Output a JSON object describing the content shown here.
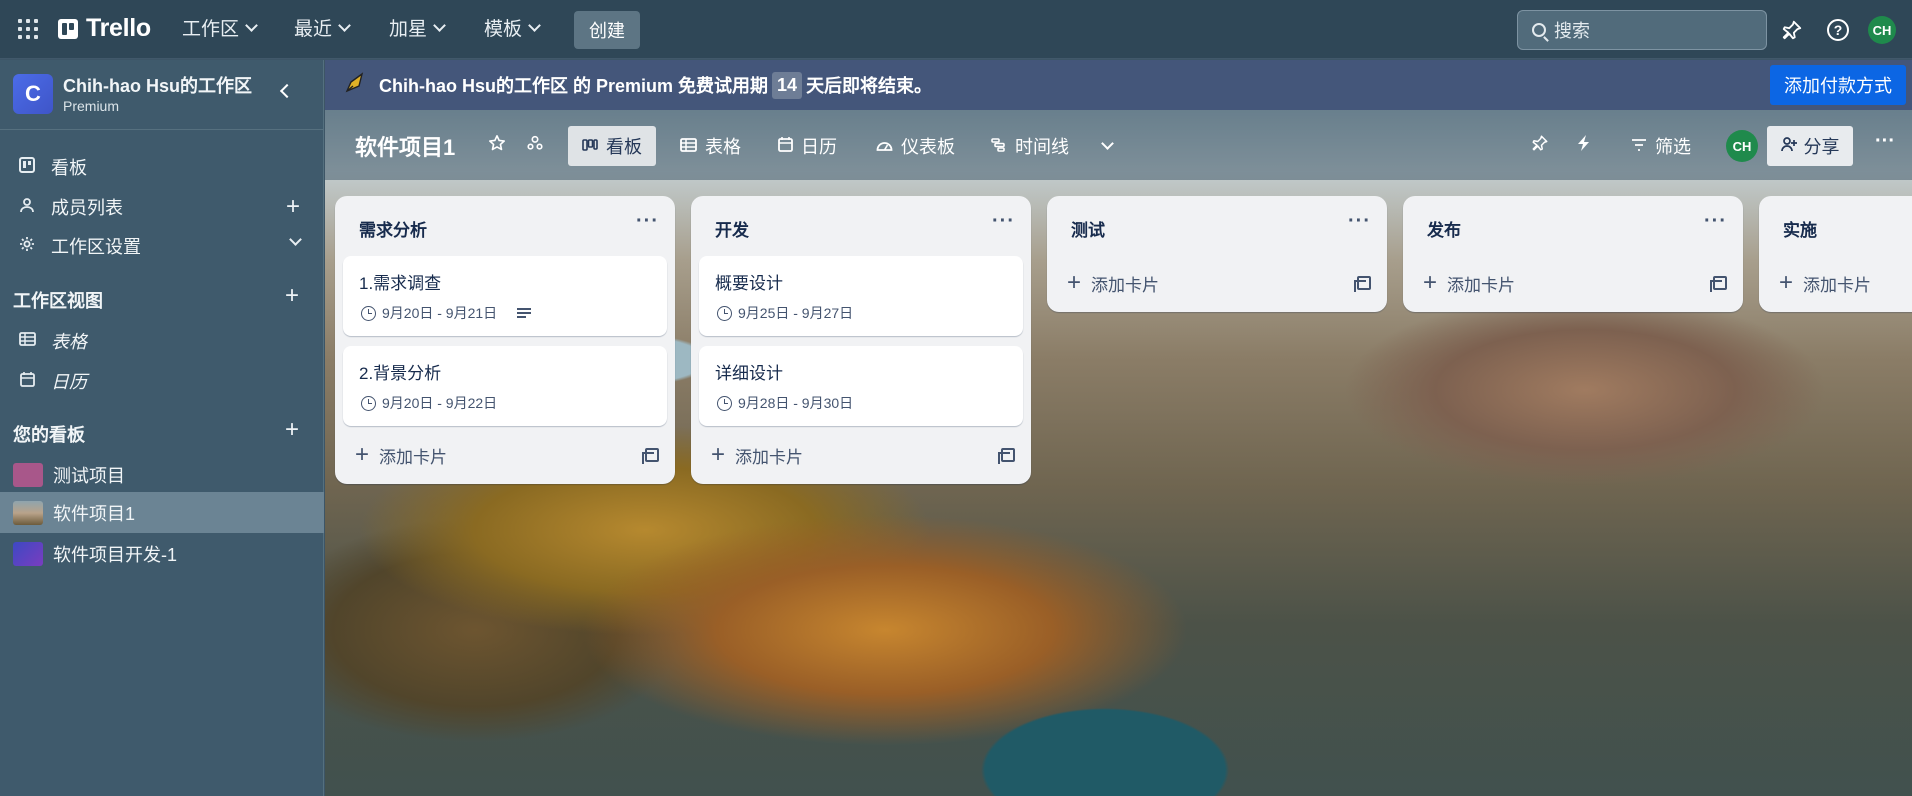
{
  "topbar": {
    "logo": "Trello",
    "menus": [
      "工作区",
      "最近",
      "加星",
      "模板"
    ],
    "create": "创建",
    "search_placeholder": "搜索",
    "avatar": "CH"
  },
  "sidebar": {
    "workspace_initial": "C",
    "workspace_name": "Chih-hao Hsu的工作区",
    "workspace_plan": "Premium",
    "nav": [
      {
        "label": "看板",
        "icon": "board-icon"
      },
      {
        "label": "成员列表",
        "icon": "person-icon"
      },
      {
        "label": "工作区设置",
        "icon": "gear-icon"
      }
    ],
    "views_heading": "工作区视图",
    "views": [
      {
        "label": "表格",
        "icon": "table-icon"
      },
      {
        "label": "日历",
        "icon": "calendar-icon"
      }
    ],
    "boards_heading": "您的看板",
    "boards": [
      {
        "label": "测试项目",
        "color": "#a8578a"
      },
      {
        "label": "软件项目1",
        "color": "#6d8897"
      },
      {
        "label": "软件项目开发-1",
        "color": "#5e3ec4"
      }
    ]
  },
  "banner": {
    "prefix": "Chih-hao Hsu的工作区 的 Premium 免费试用期",
    "days": "14",
    "suffix": "天后即将结束。",
    "button": "添加付款方式"
  },
  "board": {
    "title": "软件项目1",
    "tabs": [
      "看板",
      "表格",
      "日历",
      "仪表板",
      "时间线"
    ],
    "filter": "筛选",
    "share": "分享",
    "avatar": "CH"
  },
  "lists": [
    {
      "title": "需求分析",
      "cards": [
        {
          "title": "1.需求调查",
          "date": "9月20日 - 9月21日",
          "has_description": true
        },
        {
          "title": "2.背景分析",
          "date": "9月20日 - 9月22日",
          "has_description": false
        }
      ],
      "add_label": "添加卡片"
    },
    {
      "title": "开发",
      "cards": [
        {
          "title": "概要设计",
          "date": "9月25日 - 9月27日",
          "has_description": false
        },
        {
          "title": "详细设计",
          "date": "9月28日 - 9月30日",
          "has_description": false
        }
      ],
      "add_label": "添加卡片"
    },
    {
      "title": "测试",
      "cards": [],
      "add_label": "添加卡片"
    },
    {
      "title": "发布",
      "cards": [],
      "add_label": "添加卡片"
    },
    {
      "title": "实施",
      "cards": [],
      "add_label": "添加卡片"
    }
  ]
}
